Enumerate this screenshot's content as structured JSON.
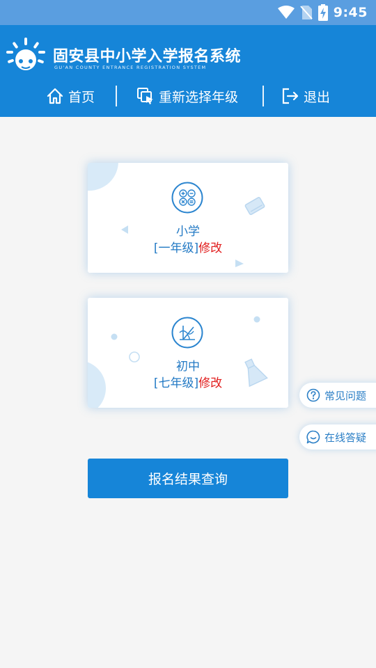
{
  "status_bar": {
    "time": "9:45"
  },
  "header": {
    "title": "固安县中小学入学报名系统",
    "subtitle": "GU'AN COUNTY ENTRANCE REGISTRATION SYSTEM"
  },
  "nav": {
    "home": "首页",
    "reselect_grade": "重新选择年级",
    "logout": "退出"
  },
  "cards": [
    {
      "title": "小学",
      "grade": "[一年级]",
      "edit": "修改"
    },
    {
      "title": "初中",
      "grade": "[七年级]",
      "edit": "修改"
    }
  ],
  "floating": {
    "faq": "常见问题",
    "online_qa": "在线答疑"
  },
  "query_button": "报名结果查询",
  "colors": {
    "primary": "#1685d8",
    "status_bar": "#5a9ee0",
    "edit_link": "#e11c1c",
    "card_text": "#2279c4",
    "background": "#f5f5f5"
  }
}
